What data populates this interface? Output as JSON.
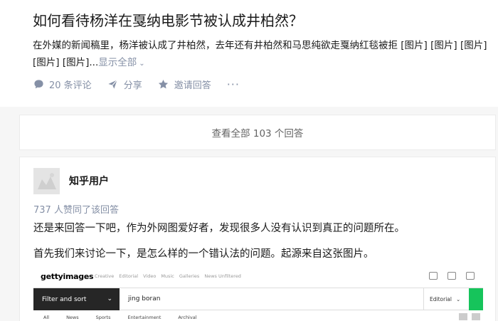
{
  "question": {
    "title": "如何看待杨洋在戛纳电影节被认成井柏然？",
    "description": "在外媒的新闻稿里，杨洋被认成了井柏然，去年还有井柏然和马思纯欲走戛纳红毯被拒 [图片] [图片] [图片] [图片] [图片]...",
    "show_all": "显示全部",
    "actions": {
      "comments": "20 条评论",
      "share": "分享",
      "invite": "邀请回答",
      "more": "···"
    }
  },
  "view_all": "查看全部 103 个回答",
  "answer": {
    "author": "知乎用户",
    "votes": "737 人赞同了该回答",
    "paragraphs": [
      "还是来回答一下吧，作为外网图爱好者，发现很多人没有认识到真正的问题所在。",
      "首先我们来讨论一下，是怎么样的一个错认法的问题。起源来自这张图片。"
    ]
  },
  "embed": {
    "logo": "gettyimages",
    "nav": [
      "Creative",
      "Editorial",
      "Video",
      "Music",
      "Galleries",
      "News Unfiltered"
    ],
    "filter_label": "Filter and sort",
    "search_value": "jing boran",
    "select_value": "Editorial",
    "tabs": [
      "All",
      "News",
      "Sports",
      "Entertainment",
      "Archival"
    ],
    "go_color": "#16c45b"
  },
  "colors": {
    "meta": "#8590a6",
    "text": "#1a1a1a",
    "background": "#f6f6f6"
  }
}
